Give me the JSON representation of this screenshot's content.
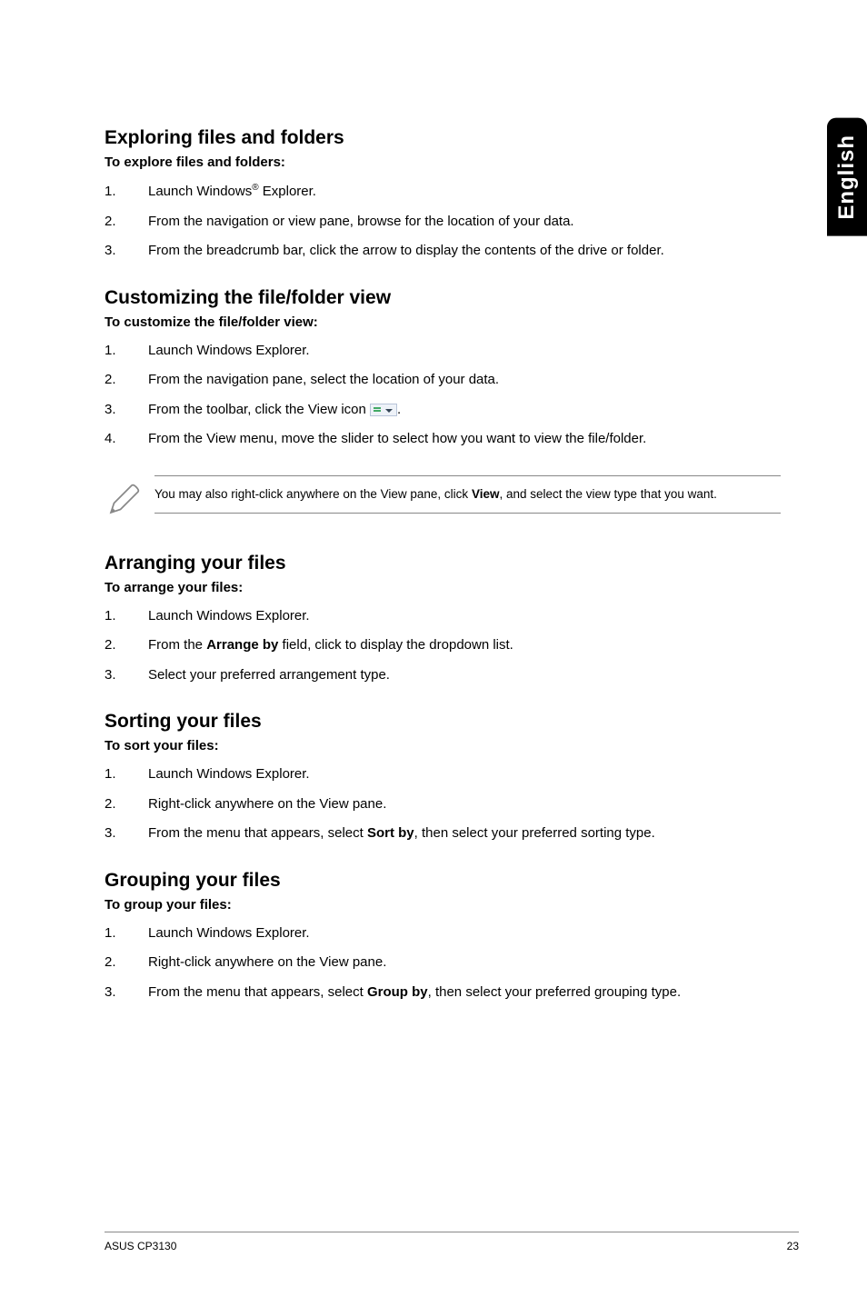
{
  "side_tab": "English",
  "sections": {
    "exploring": {
      "heading": "Exploring files and folders",
      "subhead": "To explore files and folders:",
      "items": [
        {
          "pre": "Launch Windows",
          "sup": "®",
          "post": " Explorer."
        },
        {
          "text": "From the navigation or view pane, browse for the location of your data."
        },
        {
          "text": "From the breadcrumb bar, click the arrow to display the contents of the drive or folder."
        }
      ]
    },
    "customizing": {
      "heading": "Customizing the file/folder view",
      "subhead": "To customize the file/folder view:",
      "items": [
        {
          "text": "Launch Windows Explorer."
        },
        {
          "text": "From the navigation pane, select the location of your data."
        },
        {
          "pre": "From the toolbar, click the View icon ",
          "icon": true,
          "post": "."
        },
        {
          "text": "From the View menu, move the slider to select how you want to view the file/folder."
        }
      ],
      "note_pre": "You may also right-click anywhere on the View pane, click ",
      "note_bold": "View",
      "note_post": ", and select the view type that you want."
    },
    "arranging": {
      "heading": "Arranging your files",
      "subhead": "To arrange your files:",
      "items": [
        {
          "text": "Launch Windows Explorer."
        },
        {
          "pre": "From the ",
          "bold": "Arrange by",
          "post": " field, click to display the dropdown list."
        },
        {
          "text": "Select your preferred arrangement type."
        }
      ]
    },
    "sorting": {
      "heading": "Sorting your files",
      "subhead": "To sort your files:",
      "items": [
        {
          "text": "Launch Windows Explorer."
        },
        {
          "text": "Right-click anywhere on the View pane."
        },
        {
          "pre": "From the menu that appears, select ",
          "bold": "Sort by",
          "post": ", then select your preferred sorting type."
        }
      ]
    },
    "grouping": {
      "heading": "Grouping your files",
      "subhead": "To group your files:",
      "items": [
        {
          "text": "Launch Windows Explorer."
        },
        {
          "text": "Right-click anywhere on the View pane."
        },
        {
          "pre": "From the menu that appears, select ",
          "bold": "Group by",
          "post": ", then select your preferred grouping type."
        }
      ]
    }
  },
  "footer": {
    "left": "ASUS CP3130",
    "right": "23"
  }
}
